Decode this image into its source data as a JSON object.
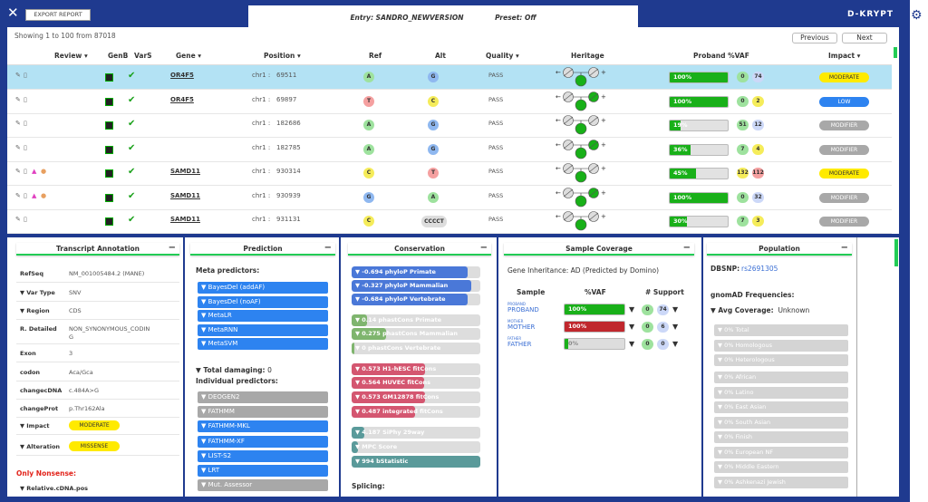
{
  "header": {
    "export_label": "EXPORT REPORT",
    "entry": "Entry: SANDRO_NEWVERSION",
    "preset": "Preset: Off",
    "logo": "D-KRYPT"
  },
  "table": {
    "showing": "Showing 1 to 100 from 87018",
    "previous": "Previous",
    "next": "Next",
    "columns": [
      "Review",
      "GenB",
      "VarS",
      "Gene",
      "Position",
      "Ref",
      "Alt",
      "Quality",
      "Heritage",
      "Proband %VAF",
      "Impact"
    ],
    "rows": [
      {
        "gene": "OR4F5",
        "chr": "chr1 :",
        "pos": "69511",
        "ref": "A",
        "alt": "G",
        "quality": "PASS",
        "vaf": 100,
        "vaf_label": "100%",
        "c1": "0",
        "c2": "74",
        "impact": "MODERATE",
        "selected": true,
        "people": 0
      },
      {
        "gene": "OR4F5",
        "chr": "chr1 :",
        "pos": "69897",
        "ref": "T",
        "alt": "C",
        "quality": "PASS",
        "vaf": 100,
        "vaf_label": "100%",
        "c1": "0",
        "c2": "2",
        "impact": "LOW",
        "people": 0
      },
      {
        "gene": "",
        "chr": "chr1 :",
        "pos": "182686",
        "ref": "A",
        "alt": "G",
        "quality": "PASS",
        "vaf": 19,
        "vaf_label": "19%",
        "c1": "51",
        "c2": "12",
        "impact": "MODIFIER",
        "people": 0
      },
      {
        "gene": "",
        "chr": "chr1 :",
        "pos": "182785",
        "ref": "A",
        "alt": "G",
        "quality": "PASS",
        "vaf": 36,
        "vaf_label": "36%",
        "c1": "7",
        "c2": "4",
        "impact": "MODIFIER",
        "people": 0
      },
      {
        "gene": "SAMD11",
        "chr": "chr1 :",
        "pos": "930314",
        "ref": "C",
        "alt": "T",
        "quality": "PASS",
        "vaf": 45,
        "vaf_label": "45%",
        "c1": "132",
        "c2": "112",
        "impact": "MODERATE",
        "people": 2
      },
      {
        "gene": "SAMD11",
        "chr": "chr1 :",
        "pos": "930939",
        "ref": "G",
        "alt": "A",
        "quality": "PASS",
        "vaf": 100,
        "vaf_label": "100%",
        "c1": "0",
        "c2": "32",
        "impact": "MODIFIER",
        "people": 2
      },
      {
        "gene": "SAMD11",
        "chr": "chr1 :",
        "pos": "931131",
        "ref": "C",
        "alt": "CCCCT",
        "quality": "PASS",
        "vaf": 30,
        "vaf_label": "30%",
        "c1": "7",
        "c2": "3",
        "impact": "MODIFIER",
        "people": 0
      }
    ]
  },
  "transcript": {
    "title": "Transcript Annotation",
    "rows": [
      {
        "k": "RefSeq",
        "v": "NM_001005484.2 (MANE)"
      },
      {
        "k": "Var Type",
        "v": "SNV"
      },
      {
        "k": "Region",
        "v": "CDS"
      },
      {
        "k": "R. Detailed",
        "v": "NON_SYNONYMOUS_CODIN\nG"
      },
      {
        "k": "Exon",
        "v": "3"
      },
      {
        "k": "codon",
        "v": "Aca/Gca"
      },
      {
        "k": "changecDNA",
        "v": "c.484A>G"
      },
      {
        "k": "changeProt",
        "v": "p.Thr162Ala"
      }
    ],
    "impact_label": "Impact",
    "impact": "MODERATE",
    "alteration_label": "Alteration",
    "alteration": "MISSENSE",
    "only_nonsense": "Only Nonsense:",
    "rel_cdna": "Relative.cDNA.pos"
  },
  "prediction": {
    "title": "Prediction",
    "meta": "Meta predictors:",
    "meta_items": [
      "BayesDel (addAF)",
      "BayesDel (noAF)",
      "MetaLR",
      "MetaRNN",
      "MetaSVM"
    ],
    "total": "Total damaging:",
    "total_value": "0",
    "individual": "Individual predictors:",
    "ind_items": [
      {
        "l": "DEOGEN2",
        "c": "#a8a8a8"
      },
      {
        "l": "FATHMM",
        "c": "#a8a8a8"
      },
      {
        "l": "FATHMM-MKL",
        "c": "#2d83f0"
      },
      {
        "l": "FATHMM-XF",
        "c": "#2d83f0"
      },
      {
        "l": "LIST-S2",
        "c": "#2d83f0"
      },
      {
        "l": "LRT",
        "c": "#2d83f0"
      },
      {
        "l": "Mut. Assessor",
        "c": "#a8a8a8"
      }
    ]
  },
  "conservation": {
    "title": "Conservation",
    "items": [
      {
        "t": "-0.694",
        "l": "phyloP Primate",
        "frac": 0.9,
        "c": "#4a78d8"
      },
      {
        "t": "-0.327",
        "l": "phyloP Mammalian",
        "frac": 0.93,
        "c": "#4a78d8"
      },
      {
        "t": "-0.684",
        "l": "phyloP Vertebrate",
        "frac": 0.9,
        "c": "#4a78d8"
      },
      {
        "t": "0.14",
        "l": "phastCons Primate",
        "frac": 0.12,
        "c": "#7fb56e"
      },
      {
        "t": "0.275",
        "l": "phastCons Mammalian",
        "frac": 0.27,
        "c": "#7fb56e"
      },
      {
        "t": "0",
        "l": "phastCons Vertebrate",
        "frac": 0.02,
        "c": "#7fb56e"
      },
      {
        "t": "0.573",
        "l": "H1-hESC fitCons",
        "frac": 0.57,
        "c": "#d45670"
      },
      {
        "t": "0.564",
        "l": "HUVEC fitCons",
        "frac": 0.56,
        "c": "#d45670"
      },
      {
        "t": "0.573",
        "l": "GM12878 fitCons",
        "frac": 0.57,
        "c": "#d45670"
      },
      {
        "t": "0.487",
        "l": "integrated fitCons",
        "frac": 0.49,
        "c": "#d45670"
      },
      {
        "t": "4.187",
        "l": "SiPhy 29way",
        "frac": 0.1,
        "c": "#5a9a9a"
      },
      {
        "t": "",
        "l": "MPC Score",
        "frac": 0.05,
        "c": "#5a9a9a"
      },
      {
        "t": "994",
        "l": "bStatistic",
        "frac": 1,
        "c": "#5a9a9a"
      }
    ],
    "splicing": "Splicing:"
  },
  "sample": {
    "title": "Sample Coverage",
    "inheritance": "Gene Inheritance: AD (Predicted by Domino)",
    "col_sample": "Sample",
    "col_vaf": "%VAF",
    "col_support": "# Support",
    "rows": [
      {
        "role": "PROBAND",
        "name": "PROBAND",
        "vaf": 100,
        "vaf_label": "100%",
        "color": "#19b019",
        "a": "0",
        "b": "74"
      },
      {
        "role": "MOTHER",
        "name": "MOTHER",
        "vaf": 100,
        "vaf_label": "100%",
        "color": "#c0272d",
        "a": "0",
        "b": "6"
      },
      {
        "role": "FATHER",
        "name": "FATHER",
        "vaf": 0,
        "vaf_label": "0%",
        "color": "#19b019",
        "a": "0",
        "b": "0"
      }
    ]
  },
  "population": {
    "title": "Population",
    "dbsnp_label": "DBSNP:",
    "dbsnp": "rs2691305",
    "gnomad": "gnomAD Frequencies:",
    "avg_label": "Avg Coverage:",
    "avg": "Unknown",
    "items1": [
      "Total",
      "Homologous",
      "Heterologous"
    ],
    "items2": [
      "African",
      "Latino",
      "East Asian",
      "South Asian",
      "Finish",
      "European NF",
      "Middle Eastern",
      "Ashkenazi Jewish"
    ],
    "pct": "0%"
  }
}
